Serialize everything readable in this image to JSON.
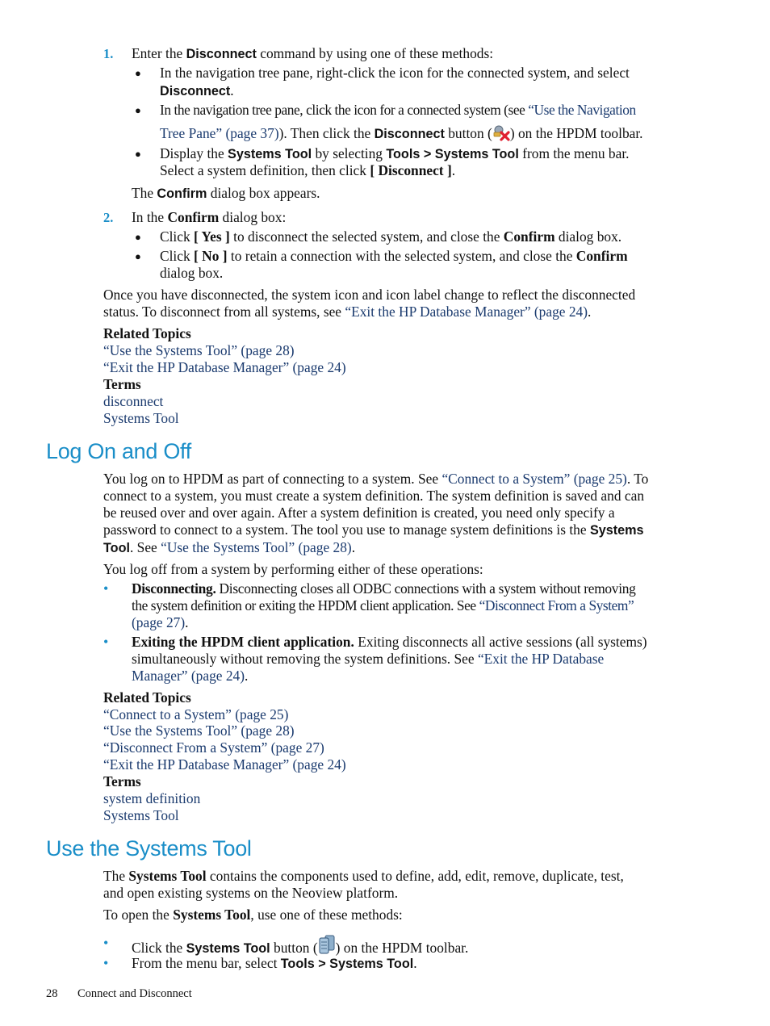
{
  "section_disconnect": {
    "steps": [
      {
        "number": "1.",
        "intro": {
          "pre": "Enter the ",
          "bold": "Disconnect",
          "post": " command by using one of these methods:"
        },
        "bullets": [
          {
            "line1": "In the navigation tree pane, right-click the icon for the connected system, and select",
            "line2_bold": "Disconnect",
            "line2_post": "."
          },
          {
            "line1_pre": "In the navigation tree pane, click the icon for a connected system (see ",
            "link_part1": "“Use the Navigation",
            "link_part2": "Tree Pane” (page 37)",
            "line2_mid": "). Then click the ",
            "line2_bold": "Disconnect",
            "line2_pre_icon": " button (",
            "icon": "disconnect-icon",
            "line2_post": ") on the HPDM toolbar."
          },
          {
            "line1_pre": "Display the ",
            "bold1": "Systems Tool",
            "mid1": " by selecting ",
            "bold2": "Tools > Systems Tool",
            "line1_post": " from the menu bar.",
            "line2_pre": "Select a system definition, then click ",
            "line2_bold": "[ Disconnect ]",
            "line2_post": "."
          }
        ],
        "after": {
          "pre": "The ",
          "bold": "Confirm",
          "post": " dialog box appears."
        }
      },
      {
        "number": "2.",
        "intro": {
          "pre": "In the ",
          "bold": "Confirm",
          "post": " dialog box:"
        },
        "bullets": [
          {
            "pre": "Click ",
            "bold1": "[ Yes ]",
            "mid": " to disconnect the selected system, and close the ",
            "bold2": "Confirm",
            "post": " dialog box."
          },
          {
            "pre": "Click ",
            "bold1": "[ No ]",
            "mid": " to retain a connection with the selected system, and close the ",
            "bold2": "Confirm",
            "line2": "dialog box."
          }
        ]
      }
    ],
    "closing": {
      "line1": "Once you have disconnected, the system icon and icon label change to reflect the disconnected",
      "line2_pre": "status. To disconnect from all systems, see ",
      "line2_link": "“Exit the HP Database Manager” (page 24)",
      "line2_post": "."
    },
    "related_heading": "Related Topics",
    "related": [
      "“Use the Systems Tool” (page 28)",
      "“Exit the HP Database Manager” (page 24)"
    ],
    "terms_heading": "Terms",
    "terms": [
      "disconnect",
      "Systems Tool"
    ]
  },
  "section_logon": {
    "title": "Log On and Off",
    "para1": {
      "l1_pre": "You log on to HPDM as part of connecting to a system. See ",
      "l1_link": "“Connect to a System” (page 25)",
      "l1_post": ". To",
      "l2": "connect to a system, you must create a system definition. The system definition is saved and can",
      "l3": "be reused over and over again. After a system definition is created, you need only specify a",
      "l4_pre": "password to connect to a system. The tool you use to manage system definitions is the ",
      "l4_bold": "Systems",
      "l5_bold": "Tool",
      "l5_pre": ". See ",
      "l5_link": "“Use the Systems Tool” (page 28)",
      "l5_post": "."
    },
    "para2": "You log off from a system by performing either of these operations:",
    "bullets": [
      {
        "bold": "Disconnecting.",
        "l1": " Disconnecting closes all ODBC connections with a system without removing",
        "l2_pre": "the system definition or exiting the HPDM client application. See ",
        "l2_link": "“Disconnect From a System”",
        "l3_link": "(page 27)",
        "l3_post": "."
      },
      {
        "bold": "Exiting the HPDM client application.",
        "l1": " Exiting disconnects all active sessions (all systems)",
        "l2_pre": "simultaneously without removing the system definitions. See ",
        "l2_link": "“Exit the HP Database",
        "l3_link": "Manager” (page 24)",
        "l3_post": "."
      }
    ],
    "related_heading": "Related Topics",
    "related": [
      "“Connect to a System” (page 25)",
      "“Use the Systems Tool” (page 28)",
      "“Disconnect From a System” (page 27)",
      "“Exit the HP Database Manager” (page 24)"
    ],
    "terms_heading": "Terms",
    "terms": [
      "system definition",
      "Systems Tool"
    ]
  },
  "section_systems_tool": {
    "title": "Use the Systems Tool",
    "para1": {
      "l1_pre": "The ",
      "l1_bold": "Systems Tool",
      "l1_post": " contains the components used to define, add, edit, remove, duplicate, test,",
      "l2": "and open existing systems on the Neoview platform."
    },
    "para2": {
      "pre": "To open the ",
      "bold": "Systems Tool",
      "post": ", use one of these methods:"
    },
    "bullets": [
      {
        "pre": "Click the ",
        "bold": "Systems Tool",
        "mid": " button (",
        "icon": "systems-tool-icon",
        "post": ") on the HPDM toolbar."
      },
      {
        "pre": "From the menu bar, select ",
        "bold": "Tools > Systems Tool",
        "post": "."
      }
    ]
  },
  "footer": {
    "page_number": "28",
    "chapter": "Connect and Disconnect"
  },
  "colors": {
    "heading": "#1a8ec8",
    "link": "#1a3a6e",
    "text": "#111111"
  }
}
